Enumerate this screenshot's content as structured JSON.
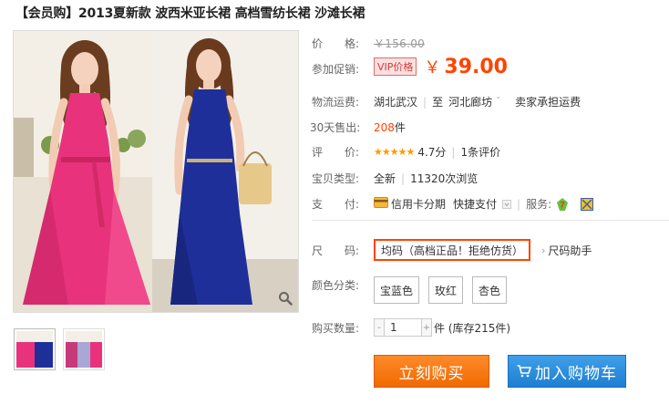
{
  "title": "【会员购】2013夏新款 波西米亚长裙 高档雪纺长裙 沙滩长裙",
  "price": {
    "label": "价　　格:",
    "value": "￥156.00"
  },
  "promo": {
    "label": "参加促销:",
    "tag": "VIP价格",
    "currency": "￥",
    "value": "39.00"
  },
  "shipping": {
    "label": "物流运费:",
    "from": "湖北武汉",
    "to_prefix": "至",
    "to": "河北廊坊",
    "chevron": "ˇ",
    "fee": "卖家承担运费"
  },
  "sales": {
    "label": "30天售出:",
    "count": "208",
    "unit": "件"
  },
  "rating": {
    "label": "评　　价:",
    "stars": "★★★★★",
    "score": "4.7分",
    "reviews": "1条评价"
  },
  "type": {
    "label": "宝贝类型:",
    "condition": "全新",
    "views": "11320次浏览"
  },
  "payment": {
    "label": "支　　付:",
    "method": "信用卡分期",
    "quick": "快捷支付",
    "service_label": "服务:"
  },
  "size": {
    "label": "尺　　码:",
    "selected": "均码（高档正品！拒绝仿货）",
    "helper": "尺码助手"
  },
  "color": {
    "label": "颜色分类:",
    "options": [
      "宝蓝色",
      "玫红",
      "杏色"
    ]
  },
  "quantity": {
    "label": "购买数量:",
    "value": "1",
    "minus": "-",
    "plus": "+",
    "stock": "件 (库存215件)"
  },
  "buttons": {
    "buy": "立刻购买",
    "cart": "加入购物车"
  },
  "colors": {
    "accent": "#ff4400",
    "buy": "#f57a00",
    "cart": "#2b8de0",
    "dress_pink": "#e8337c",
    "dress_blue": "#1f2f9a"
  },
  "icons": [
    "search-zoom-icon",
    "credit-card-icon",
    "dropdown-icon",
    "service-7day-icon",
    "service-guarantee-icon",
    "cart-icon"
  ]
}
